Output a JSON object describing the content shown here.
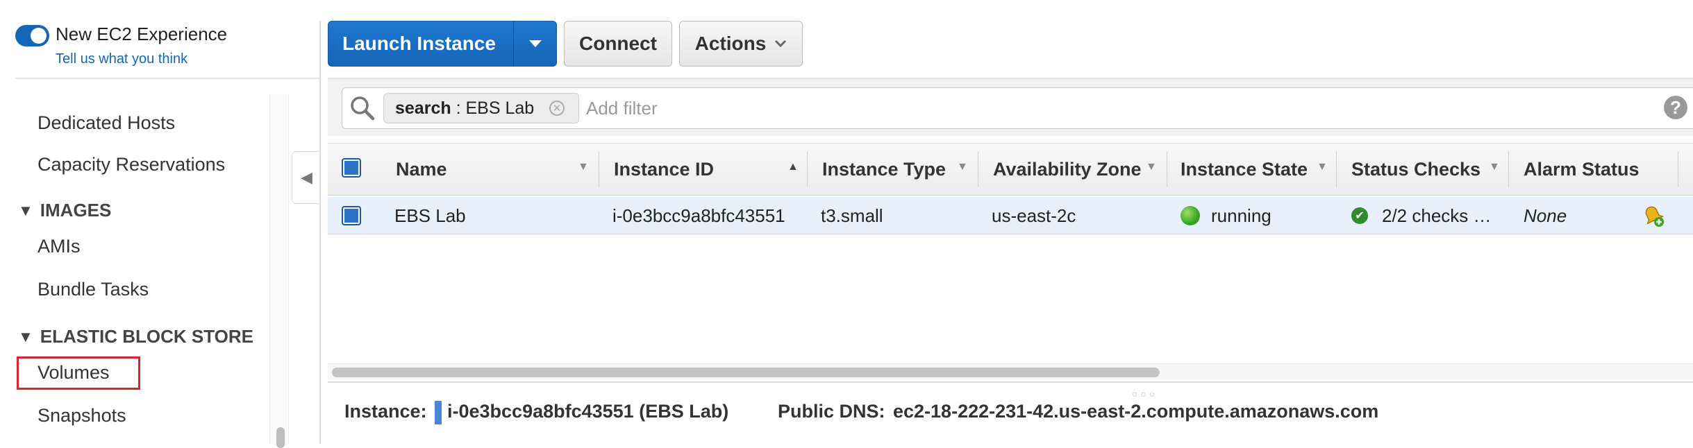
{
  "sidebar": {
    "experience_toggle_label": "New EC2 Experience",
    "feedback_link": "Tell us what you think",
    "items": [
      {
        "label": "Dedicated Hosts"
      },
      {
        "label": "Capacity Reservations"
      }
    ],
    "sections": [
      {
        "title": "IMAGES",
        "items": [
          {
            "label": "AMIs"
          },
          {
            "label": "Bundle Tasks"
          }
        ]
      },
      {
        "title": "ELASTIC BLOCK STORE",
        "items": [
          {
            "label": "Volumes",
            "highlighted": true
          },
          {
            "label": "Snapshots"
          }
        ]
      }
    ]
  },
  "toolbar": {
    "launch_label": "Launch Instance",
    "connect_label": "Connect",
    "actions_label": "Actions"
  },
  "filter": {
    "token_key": "search",
    "token_value": "EBS Lab",
    "placeholder": "Add filter"
  },
  "table": {
    "columns": [
      "Name",
      "Instance ID",
      "Instance Type",
      "Availability Zone",
      "Instance State",
      "Status Checks",
      "Alarm Status"
    ],
    "sorted_column": "Instance ID",
    "rows": [
      {
        "name": "EBS Lab",
        "instance_id": "i-0e3bcc9a8bfc43551",
        "instance_type": "t3.small",
        "availability_zone": "us-east-2c",
        "instance_state": "running",
        "status_checks": "2/2 checks …",
        "alarm_status": "None",
        "selected": true
      }
    ]
  },
  "details": {
    "instance_label": "Instance:",
    "instance_value": "i-0e3bcc9a8bfc43551 (EBS Lab)",
    "dns_label": "Public DNS:",
    "dns_value": "ec2-18-222-231-42.us-east-2.compute.amazonaws.com"
  },
  "colors": {
    "accent": "#1466b8",
    "row_selected": "#e8f1fb",
    "highlight_box": "#d9242b",
    "running": "#3aa61f"
  },
  "icons": [
    "search-icon",
    "clear-filter-icon",
    "help-icon",
    "dropdown-caret-icon",
    "sort-asc-icon",
    "running-state-icon",
    "status-ok-icon",
    "alarm-bell-icon",
    "collapse-sidebar-icon",
    "section-collapse-icon"
  ]
}
